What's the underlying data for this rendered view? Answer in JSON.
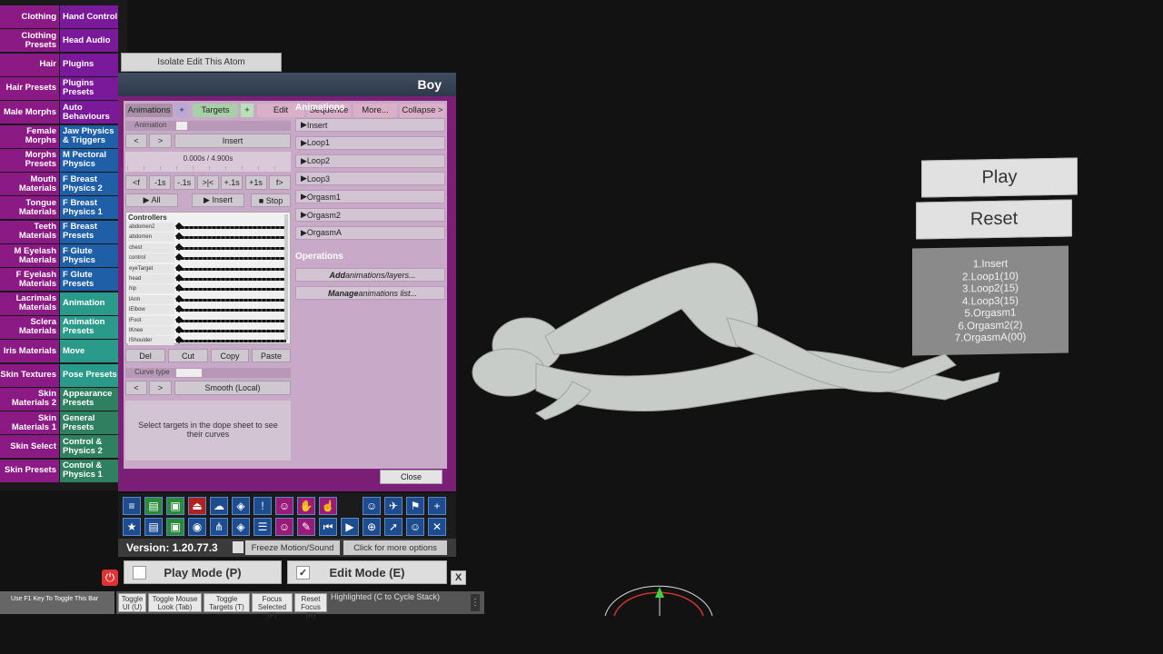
{
  "sidebar": [
    [
      "Clothing",
      "Hand Control"
    ],
    [
      "Clothing Presets",
      "Head Audio"
    ],
    [
      "Hair",
      "Plugins"
    ],
    [
      "Hair Presets",
      "Plugins Presets"
    ],
    [
      "Male Morphs",
      "Auto Behaviours"
    ],
    [
      "Female Morphs",
      "Jaw Physics & Triggers"
    ],
    [
      "Morphs Presets",
      "M Pectoral Physics"
    ],
    [
      "Mouth Materials",
      "F Breast Physics 2"
    ],
    [
      "Tongue Materials",
      "F Breast Physics 1"
    ],
    [
      "Teeth Materials",
      "F Breast Presets"
    ],
    [
      "M Eyelash Materials",
      "F Glute Physics"
    ],
    [
      "F Eyelash Materials",
      "F Glute Presets"
    ],
    [
      "Lacrimals Materials",
      "Animation"
    ],
    [
      "Sclera Materials",
      "Animation Presets"
    ],
    [
      "Iris Materials",
      "Move"
    ],
    [
      "Skin Textures",
      "Pose Presets"
    ],
    [
      "Skin Materials 2",
      "Appearance Presets"
    ],
    [
      "Skin Materials 1",
      "General Presets"
    ],
    [
      "Skin Select",
      "Control & Physics 2"
    ],
    [
      "Skin Presets",
      "Control & Physics 1"
    ]
  ],
  "isolate_label": "Isolate Edit This Atom",
  "window_title": "Boy",
  "tabs": {
    "animations": "Animations",
    "add1": "+",
    "targets": "Targets",
    "add2": "+",
    "edit": "Edit",
    "sequence": "Sequence",
    "more": "More...",
    "collapse": "Collapse >"
  },
  "animation_label": "Animation",
  "prev": "<",
  "next": ">",
  "insert": "Insert",
  "time_readout": "0.000s / 4.900s",
  "step_buttons": [
    "<f",
    "-1s",
    "-.1s",
    ">|<",
    "+.1s",
    "+1s",
    "f>"
  ],
  "play_all": "▶ All",
  "play_insert": "▶ Insert",
  "stop": "■ Stop",
  "controllers_header": "Controllers",
  "controllers": [
    "abdomen2",
    "abdomen",
    "chest",
    "control",
    "eyeTarget",
    "head",
    "hip",
    "lArm",
    "lElbow",
    "lFoot",
    "lKnee",
    "lShoulder"
  ],
  "edit_buttons": [
    "Del",
    "Cut",
    "Copy",
    "Paste"
  ],
  "curve_type_label": "Curve type",
  "curve_value": "Smooth (Local)",
  "dope_hint": "Select targets in the dope sheet to see their curves",
  "animations_header": "Animations",
  "animations": [
    "Insert",
    "Loop1",
    "Loop2",
    "Loop3",
    "Orgasm1",
    "Orgasm2",
    "OrgasmA"
  ],
  "operations_header": "Operations",
  "op_add_em": "Add",
  "op_add_rest": " animations/layers...",
  "op_manage_em": "Manage",
  "op_manage_rest": " animations list...",
  "close": "Close",
  "version": "Version: 1.20.77.3",
  "freeze": "Freeze Motion/Sound",
  "more_options": "Click for more options",
  "play_mode": "Play Mode (P)",
  "edit_mode": "Edit Mode (E)",
  "x_close": "X",
  "f1_hint": "Use F1 Key To Toggle This Bar",
  "bottom_buttons": [
    "Toggle UI (U)",
    "Toggle Mouse Look (Tab)",
    "Toggle Targets (T)",
    "Focus Selected (F)",
    "Reset Focus (R)"
  ],
  "highlighted": "Highlighted (C to Cycle Stack)",
  "scene_play": "Play",
  "scene_reset": "Reset",
  "scene_list": [
    "1.Insert",
    "2.Loop1(10)",
    "3.Loop2(15)",
    "4.Loop3(15)",
    "5.Orgasm1",
    "6.Orgasm2(2)",
    "7.OrgasmA(00)"
  ],
  "colors": {
    "magenta": "#8c1a84",
    "purple": "#6a1b9a",
    "teal": "#167a80",
    "blue": "#1e5fa8",
    "green": "#2e8b6e"
  }
}
